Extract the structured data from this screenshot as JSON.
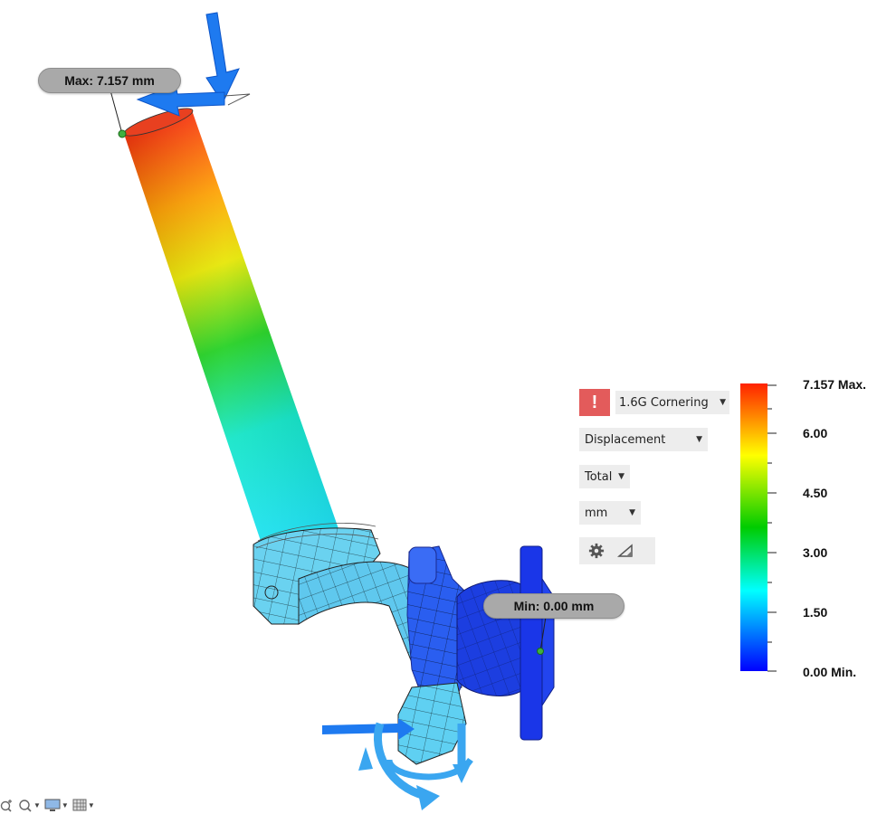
{
  "callouts": {
    "max_label": "Max: 7.157 mm",
    "min_label": "Min: 0.00 mm"
  },
  "panel": {
    "warning_glyph": "!",
    "load_case": "1.6G Cornering",
    "result_type": "Displacement",
    "component": "Total",
    "unit": "mm",
    "settings_icon": "gear-icon",
    "deform_icon": "deformation-scale-icon"
  },
  "legend": {
    "labels": [
      "7.157 Max.",
      "6.00",
      "4.50",
      "3.00",
      "1.50",
      "0.00 Min."
    ],
    "max_value": 7.157,
    "min_value": 0.0,
    "gradient_colors": [
      "#ff2200",
      "#ffff00",
      "#00cc00",
      "#00ffff",
      "#0000ff"
    ]
  },
  "toolbar": {
    "icons": [
      "zoom-window-icon",
      "zoom-icon",
      "display-settings-icon",
      "grid-settings-icon"
    ]
  },
  "colors": {
    "callout_bg": "#a9a9a9",
    "load_arrow": "#1e7af0",
    "constraint_arrow": "#3aa6f0",
    "warning": "#e35b5b"
  }
}
